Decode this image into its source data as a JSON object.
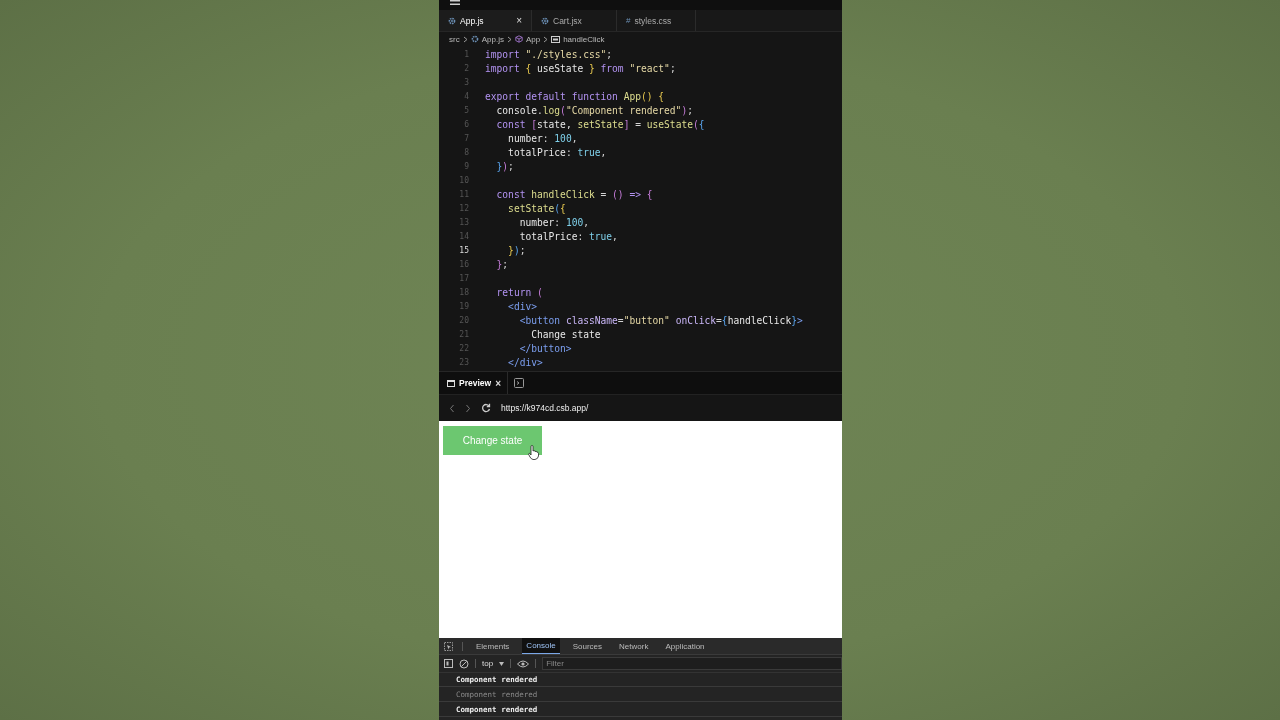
{
  "editor": {
    "tabs": [
      {
        "label": "App.js",
        "kind": "react",
        "selected": true,
        "close": "×"
      },
      {
        "label": "Cart.jsx",
        "kind": "react",
        "selected": false
      },
      {
        "label": "styles.css",
        "kind": "css",
        "glyph": "#",
        "selected": false
      }
    ],
    "breadcrumb": [
      {
        "label": "src",
        "kind": "folder"
      },
      {
        "label": "App.js",
        "kind": "react"
      },
      {
        "label": "App",
        "kind": "component"
      },
      {
        "label": "handleClick",
        "kind": "method"
      }
    ],
    "lines": [
      {
        "n": "1",
        "current": false,
        "tokens": [
          {
            "t": "import ",
            "kind": "kw"
          },
          {
            "t": "\"./styles.css\"",
            "kind": "str"
          },
          {
            "t": ";",
            "kind": "p"
          }
        ]
      },
      {
        "n": "2",
        "current": false,
        "tokens": [
          {
            "t": "import ",
            "kind": "kw"
          },
          {
            "t": "{",
            "kind": "brk"
          },
          {
            "t": " useState ",
            "kind": "id"
          },
          {
            "t": "} ",
            "kind": "brk"
          },
          {
            "t": "from ",
            "kind": "kw"
          },
          {
            "t": "\"react\"",
            "kind": "str"
          },
          {
            "t": ";",
            "kind": "p"
          }
        ]
      },
      {
        "n": "3",
        "current": false
      },
      {
        "n": "4",
        "current": false,
        "tokens": [
          {
            "t": "export default function ",
            "kind": "kw"
          },
          {
            "t": "App",
            "kind": "fn"
          },
          {
            "t": "() ",
            "kind": "brk"
          },
          {
            "t": "{",
            "kind": "brk"
          }
        ]
      },
      {
        "n": "5",
        "current": false,
        "tokens": [
          {
            "t": "  console",
            "kind": "id"
          },
          {
            "t": ".",
            "kind": "p"
          },
          {
            "t": "log",
            "kind": "fn"
          },
          {
            "t": "(",
            "kind": "brk2"
          },
          {
            "t": "\"Component rendered\"",
            "kind": "str"
          },
          {
            "t": ")",
            "kind": "brk2"
          },
          {
            "t": ";",
            "kind": "p"
          }
        ]
      },
      {
        "n": "6",
        "current": false,
        "tokens": [
          {
            "t": "  const ",
            "kind": "kw"
          },
          {
            "t": "[",
            "kind": "brk2"
          },
          {
            "t": "state, ",
            "kind": "id"
          },
          {
            "t": "setState",
            "kind": "fn"
          },
          {
            "t": "]",
            "kind": "brk2"
          },
          {
            "t": " = ",
            "kind": "p"
          },
          {
            "t": "useState",
            "kind": "fn"
          },
          {
            "t": "(",
            "kind": "brk2"
          },
          {
            "t": "{",
            "kind": "brk3"
          }
        ]
      },
      {
        "n": "7",
        "current": false,
        "tokens": [
          {
            "t": "    number",
            "kind": "id"
          },
          {
            "t": ": ",
            "kind": "p"
          },
          {
            "t": "100",
            "kind": "num"
          },
          {
            "t": ",",
            "kind": "p"
          }
        ]
      },
      {
        "n": "8",
        "current": false,
        "tokens": [
          {
            "t": "    totalPrice",
            "kind": "id"
          },
          {
            "t": ": ",
            "kind": "p"
          },
          {
            "t": "true",
            "kind": "num"
          },
          {
            "t": ",",
            "kind": "p"
          }
        ]
      },
      {
        "n": "9",
        "current": false,
        "tokens": [
          {
            "t": "  }",
            "kind": "brk3"
          },
          {
            "t": ")",
            "kind": "brk2"
          },
          {
            "t": ";",
            "kind": "p"
          }
        ]
      },
      {
        "n": "10",
        "current": false
      },
      {
        "n": "11",
        "current": false,
        "tokens": [
          {
            "t": "  const ",
            "kind": "kw"
          },
          {
            "t": "handleClick",
            "kind": "fn"
          },
          {
            "t": " = ",
            "kind": "p"
          },
          {
            "t": "()",
            "kind": "brk2"
          },
          {
            "t": " => ",
            "kind": "kw"
          },
          {
            "t": "{",
            "kind": "brk2"
          }
        ]
      },
      {
        "n": "12",
        "current": false,
        "tokens": [
          {
            "t": "    setState",
            "kind": "fn"
          },
          {
            "t": "(",
            "kind": "brk3"
          },
          {
            "t": "{",
            "kind": "brk"
          }
        ]
      },
      {
        "n": "13",
        "current": false,
        "tokens": [
          {
            "t": "      number",
            "kind": "id"
          },
          {
            "t": ": ",
            "kind": "p"
          },
          {
            "t": "100",
            "kind": "num"
          },
          {
            "t": ",",
            "kind": "p"
          }
        ]
      },
      {
        "n": "14",
        "current": false,
        "tokens": [
          {
            "t": "      totalPrice",
            "kind": "id"
          },
          {
            "t": ": ",
            "kind": "p"
          },
          {
            "t": "true",
            "kind": "num"
          },
          {
            "t": ",",
            "kind": "p"
          }
        ]
      },
      {
        "n": "15",
        "current": true,
        "tokens": [
          {
            "t": "    }",
            "kind": "brk"
          },
          {
            "t": ")",
            "kind": "brk3"
          },
          {
            "t": ";",
            "kind": "p"
          }
        ]
      },
      {
        "n": "16",
        "current": false,
        "tokens": [
          {
            "t": "  }",
            "kind": "brk2"
          },
          {
            "t": ";",
            "kind": "p"
          }
        ]
      },
      {
        "n": "17",
        "current": false
      },
      {
        "n": "18",
        "current": false,
        "tokens": [
          {
            "t": "  return ",
            "kind": "kw"
          },
          {
            "t": "(",
            "kind": "brk2"
          }
        ]
      },
      {
        "n": "19",
        "current": false,
        "tokens": [
          {
            "t": "    <div>",
            "kind": "tag"
          }
        ]
      },
      {
        "n": "20",
        "current": false,
        "tokens": [
          {
            "t": "      <button ",
            "kind": "tag"
          },
          {
            "t": "className",
            "kind": "attr"
          },
          {
            "t": "=",
            "kind": "p"
          },
          {
            "t": "\"button\" ",
            "kind": "str"
          },
          {
            "t": "onClick",
            "kind": "attr"
          },
          {
            "t": "=",
            "kind": "p"
          },
          {
            "t": "{",
            "kind": "brk3"
          },
          {
            "t": "handleClick",
            "kind": "id"
          },
          {
            "t": "}",
            "kind": "brk3"
          },
          {
            "t": ">",
            "kind": "tag"
          }
        ]
      },
      {
        "n": "21",
        "current": false,
        "tokens": [
          {
            "t": "        Change state",
            "kind": "id"
          }
        ]
      },
      {
        "n": "22",
        "current": false,
        "tokens": [
          {
            "t": "      </button>",
            "kind": "tag"
          }
        ]
      },
      {
        "n": "23",
        "current": false,
        "tokens": [
          {
            "t": "    </div>",
            "kind": "tag"
          }
        ]
      }
    ]
  },
  "preview": {
    "tab": {
      "label": "Preview",
      "close": "×",
      "selected": true
    },
    "url": "https://k974cd.csb.app/",
    "button": "Change state"
  },
  "devtools": {
    "tabs": [
      {
        "label": "Elements",
        "selected": false
      },
      {
        "label": "Console",
        "selected": true
      },
      {
        "label": "Sources",
        "selected": false
      },
      {
        "label": "Network",
        "selected": false
      },
      {
        "label": "Application",
        "selected": false
      }
    ],
    "context": "top",
    "filter_placeholder": "Filter",
    "messages": [
      {
        "text": "Component rendered",
        "dimmed": false
      },
      {
        "text": "Component rendered",
        "dimmed": true
      },
      {
        "text": "Component rendered",
        "dimmed": false
      }
    ]
  }
}
